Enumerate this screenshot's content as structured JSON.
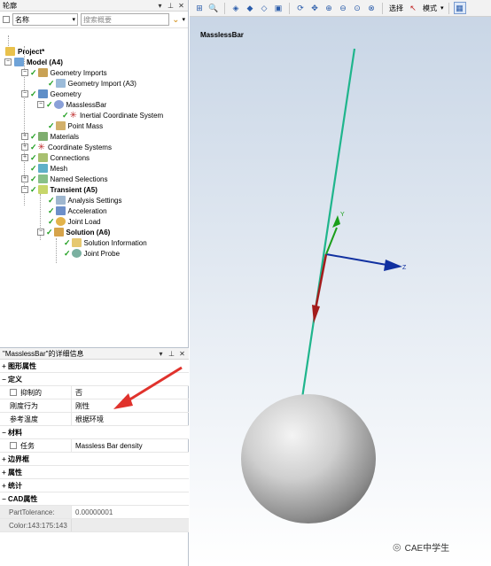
{
  "outline": {
    "title": "轮廓",
    "filter_select": "名称",
    "search_placeholder": "搜索概要",
    "tree": {
      "project": "Project*",
      "model": "Model (A4)",
      "geometry_imports": "Geometry Imports",
      "geometry_import_a3": "Geometry Import (A3)",
      "geometry": "Geometry",
      "massless_bar": "MasslessBar",
      "inertial_cs": "Inertial Coordinate System",
      "point_mass": "Point Mass",
      "materials": "Materials",
      "coordinate_systems": "Coordinate Systems",
      "connections": "Connections",
      "mesh": "Mesh",
      "named_selections": "Named Selections",
      "transient": "Transient (A5)",
      "analysis_settings": "Analysis Settings",
      "acceleration": "Acceleration",
      "joint_load": "Joint Load",
      "solution": "Solution (A6)",
      "solution_information": "Solution Information",
      "joint_probe": "Joint Probe"
    }
  },
  "details": {
    "title": "\"MasslessBar\"的详细信息",
    "rows": {
      "graphics_props": "图形属性",
      "definition": "定义",
      "suppressed_label": "抑制的",
      "suppressed_value": "否",
      "stiffness_label": "刚度行为",
      "stiffness_value": "刚性",
      "ref_temp_label": "参考温度",
      "ref_temp_value": "根据环境",
      "material": "材料",
      "assignment_label": "任务",
      "assignment_value": "Massless Bar density",
      "bounding_box": "边界框",
      "properties": "属性",
      "statistics": "统计",
      "cad_props": "CAD属性",
      "part_tol_label": "PartTolerance:",
      "part_tol_value": "0.00000001",
      "color_label": "Color:143:175:143"
    }
  },
  "graphics": {
    "toolbar": {
      "select_label": "选择",
      "mode_label": "模式"
    },
    "viewport_title": "MasslessBar",
    "axis_y": "Y",
    "axis_z": "Z",
    "watermark": "CAE中学生"
  },
  "colors": {
    "bar": "#1fb58c",
    "arrow_red": "#a31b1b",
    "axis_blue": "#1030a0",
    "axis_green": "#1a9e1a",
    "annotation": "#e0322c"
  }
}
